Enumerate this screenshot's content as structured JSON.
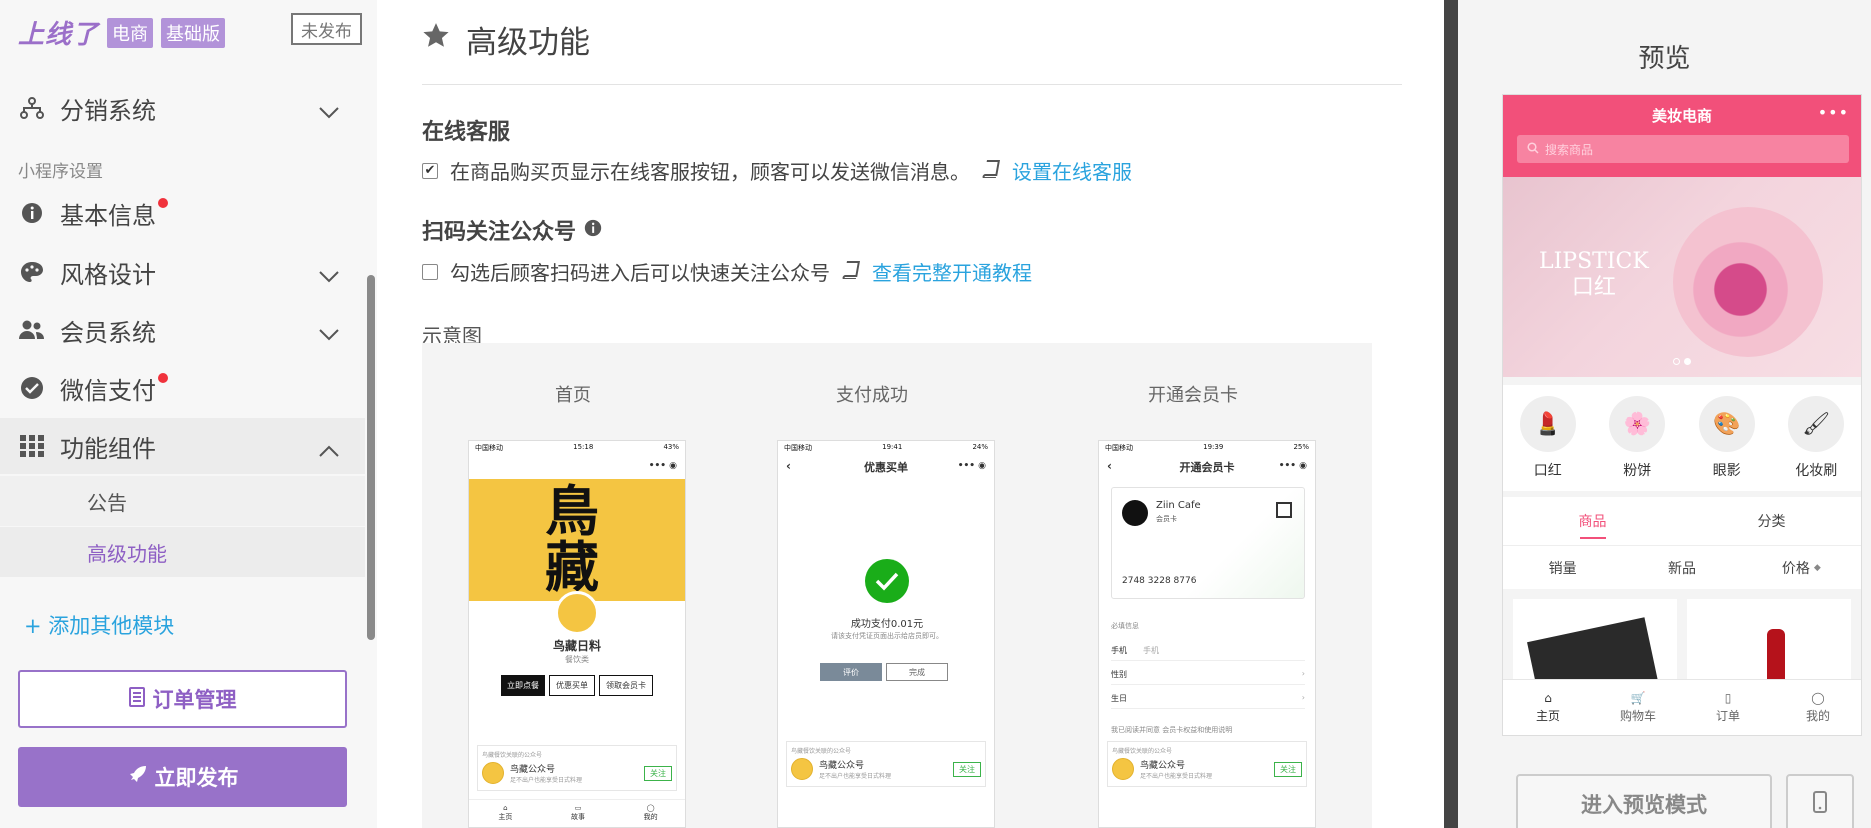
{
  "brand": {
    "logo": "上线了",
    "tag1": "电商",
    "tag2": "基础版",
    "status_button": "未发布"
  },
  "sidebar": {
    "distribution": "分销系统",
    "section_label": "小程序设置",
    "basic_info": "基本信息",
    "style_design": "风格设计",
    "member_system": "会员系统",
    "wechat_pay": "微信支付",
    "components": "功能组件",
    "sub_notice": "公告",
    "sub_advanced": "高级功能",
    "add_module": "+ 添加其他模块",
    "order_manage": "订单管理",
    "publish_now": "立即发布"
  },
  "main": {
    "title": "高级功能",
    "online_cs": {
      "heading": "在线客服",
      "option_text": "在商品购买页显示在线客服按钮，顾客可以发送微信消息。",
      "option_checked": true,
      "link": "设置在线客服"
    },
    "follow_account": {
      "heading": "扫码关注公众号",
      "option_text": "勾选后顾客扫码进入后可以快速关注公众号",
      "option_checked": false,
      "link": "查看完整开通教程"
    },
    "demo": {
      "label": "示意图",
      "captions": [
        "首页",
        "支付成功",
        "开通会员卡"
      ],
      "phone1": {
        "time": "15:18",
        "carrier": "中国移动",
        "battery": "43%",
        "shop_name": "鸟藏日料",
        "shop_type": "餐饮类",
        "btn1": "立即点餐",
        "btn2": "优惠买单",
        "btn3": "领取会员卡",
        "account_head": "鸟藏餐饮关联的公众号",
        "account_name": "鸟藏公众号",
        "account_desc": "足不出户也能享受日式料理",
        "follow": "关注",
        "tabs": [
          "主页",
          "故事",
          "我的"
        ]
      },
      "phone2": {
        "time": "19:41",
        "carrier": "中国移动",
        "battery": "24%",
        "nav": "优惠买单",
        "success": "成功支付0.01元",
        "hint": "请该支付凭证页面出示给店员即可。",
        "btn_rate": "评价",
        "btn_done": "完成",
        "account_head": "鸟藏餐饮关联的公众号",
        "account_name": "鸟藏公众号",
        "account_desc": "足不出户也能享受日式料理",
        "follow": "关注"
      },
      "phone3": {
        "time": "19:39",
        "carrier": "中国移动",
        "battery": "25%",
        "nav": "开通会员卡",
        "card_name": "Ziin Cafe",
        "card_sub": "会员卡",
        "card_number": "2748 3228 8776",
        "required": "必填信息",
        "phone_label": "手机",
        "phone_placeholder": "手机",
        "gender_label": "性别",
        "birthday_label": "生日",
        "agree": "我已阅读并同意 会员卡权益和使用说明",
        "account_head": "鸟藏餐饮关联的公众号",
        "account_name": "鸟藏公众号",
        "account_desc": "足不出户也能享受日式料理",
        "follow": "关注"
      }
    }
  },
  "preview": {
    "title": "预览",
    "app_title": "美妆电商",
    "search_placeholder": "搜索商品",
    "banner_text_1": "LIPSTICK",
    "banner_text_2": "口红",
    "categories": [
      "口红",
      "粉饼",
      "眼影",
      "化妆刷"
    ],
    "tabs": [
      "商品",
      "分类"
    ],
    "sort": [
      "销量",
      "新品",
      "价格"
    ],
    "tabbar": [
      "主页",
      "购物车",
      "订单",
      "我的"
    ],
    "btn_preview_mode": "进入预览模式"
  },
  "colors": {
    "accent": "#9872c9",
    "link": "#2aa3de",
    "preview_brand": "#f2507a",
    "badge_red": "#f0323c"
  }
}
